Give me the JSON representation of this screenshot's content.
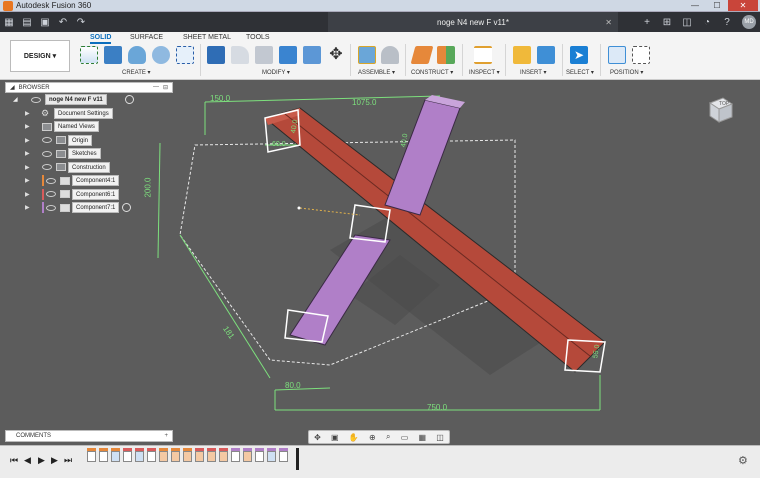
{
  "titlebar": {
    "app_title": "Autodesk Fusion 360",
    "min": "—",
    "max": "☐",
    "close": "✕"
  },
  "tabbar": {
    "doc_title": "noge N4 new F v11*",
    "doc_close": "✕",
    "new_tab": "+",
    "avatar": "MD"
  },
  "toolbar": {
    "design": "DESIGN ▾",
    "tabs": [
      "SOLID",
      "SURFACE",
      "SHEET METAL",
      "TOOLS"
    ],
    "groups": [
      "CREATE ▾",
      "MODIFY ▾",
      "ASSEMBLE ▾",
      "CONSTRUCT ▾",
      "INSPECT ▾",
      "INSERT ▾",
      "SELECT ▾",
      "POSITION ▾"
    ]
  },
  "browser": {
    "title": "BROWSER",
    "root": "noge N4 new F v11",
    "items": [
      "Document Settings",
      "Named Views",
      "Origin",
      "Sketches",
      "Construction",
      "Component4:1",
      "Component6:1",
      "Component7:1"
    ]
  },
  "dimensions": {
    "d150": "150.0",
    "d1075": "1075.0",
    "d40a": "40.0",
    "d40b": "40.0",
    "d60": "60.0",
    "d200": "200.0",
    "d181": "181",
    "d80": "80.0",
    "d750": "750.0",
    "d55": "55.0"
  },
  "comments": {
    "label": "COMMENTS",
    "plus": "+"
  },
  "viewcube": {
    "face": "TOP"
  },
  "colors": {
    "red_beam": "#b5493a",
    "purple_beam": "#b07fc8",
    "accent": "#0b6ebd",
    "sketch": "#7de07d"
  }
}
